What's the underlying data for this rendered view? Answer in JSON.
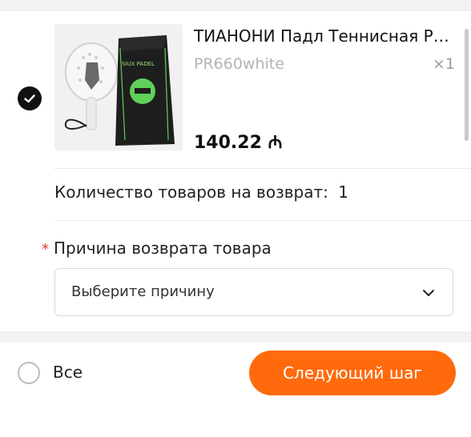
{
  "item": {
    "selected": true,
    "title": "ТИАНОНИ Падл Теннисная Рак...",
    "variant": "PR660white",
    "quantity": "×1",
    "price": "140.22",
    "currency_symbol": "₼",
    "image_icon": "padel-racket-and-bag-image"
  },
  "return_quantity": {
    "label": "Количество товаров на возврат:",
    "value": "1"
  },
  "reason": {
    "required_mark": "*",
    "label": "Причина возврата товара",
    "placeholder": "Выберите причину"
  },
  "footer": {
    "select_all_label": "Все",
    "next_button_label": "Следующий шаг"
  },
  "colors": {
    "accent": "#ff6a0d",
    "required": "#e0422f",
    "muted": "#b4b4b4"
  }
}
